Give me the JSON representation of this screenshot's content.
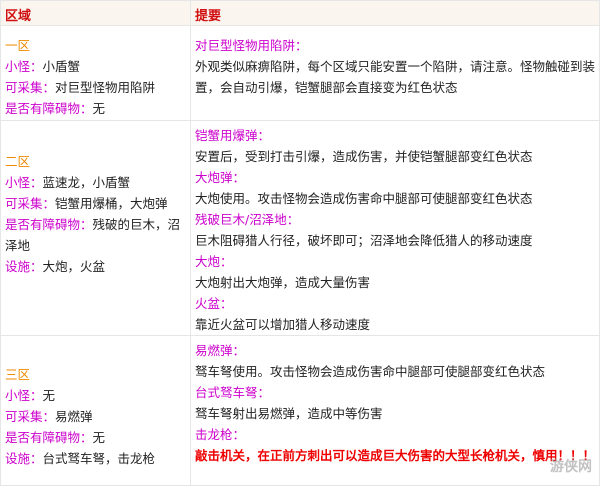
{
  "header": {
    "col1": "区域",
    "col2": "提要"
  },
  "rows": [
    {
      "zone": "一区",
      "left": [
        {
          "label": "小怪：",
          "value": "小盾蟹"
        },
        {
          "label": "可采集：",
          "value": "对巨型怪物用陷阱"
        },
        {
          "label": "是否有障碍物：",
          "value": "无"
        }
      ],
      "right": [
        {
          "title": "对巨型怪物用陷阱：",
          "text": "外观类似麻痹陷阱，每个区域只能安置一个陷阱，请注意。怪物触碰到装置，会自动引爆，铠蟹腿部会直接变为红色状态"
        }
      ]
    },
    {
      "zone": "二区",
      "left": [
        {
          "label": "小怪：",
          "value": "蓝速龙，小盾蟹"
        },
        {
          "label": "可采集：",
          "value": "铠蟹用爆桶，大炮弹"
        },
        {
          "label": "是否有障碍物：",
          "value": "残破的巨木，沼泽地"
        },
        {
          "label": "设施：",
          "value": "大炮，火盆"
        }
      ],
      "right": [
        {
          "title": "铠蟹用爆弹：",
          "text": "安置后，受到打击引爆，造成伤害，并使铠蟹腿部变红色状态"
        },
        {
          "title": "大炮弹：",
          "text": "大炮使用。攻击怪物会造成伤害命中腿部可使腿部变红色状态"
        },
        {
          "title": "残破巨木/沼泽地：",
          "text": "巨木阻碍猎人行径，破坏即可；沼泽地会降低猎人的移动速度"
        },
        {
          "title": "大炮：",
          "text": "大炮射出大炮弹，造成大量伤害"
        },
        {
          "title": "火盆：",
          "text": "靠近火盆可以增加猎人移动速度"
        }
      ]
    },
    {
      "zone": "三区",
      "left": [
        {
          "label": "小怪：",
          "value": "无"
        },
        {
          "label": "可采集：",
          "value": "易燃弹"
        },
        {
          "label": "是否有障碍物：",
          "value": "无"
        },
        {
          "label": "设施：",
          "value": "台式驽车弩，击龙枪"
        }
      ],
      "right": [
        {
          "title": "易燃弹：",
          "text": "驽车弩使用。攻击怪物会造成伤害命中腿部可使腿部变红色状态"
        },
        {
          "title": "台式驽车弩：",
          "text": "驽车弩射出易燃弹，造成中等伤害"
        },
        {
          "title": "击龙枪：",
          "text": "敲击机关，在正前方刺出可以造成巨大伤害的大型长枪机关，慎用！！！"
        }
      ]
    }
  ],
  "watermark": "游侠网",
  "colors": {
    "zone": "#f08a00",
    "label": "#cc00cc",
    "warning": "#ee0000",
    "header": "#d01010"
  }
}
